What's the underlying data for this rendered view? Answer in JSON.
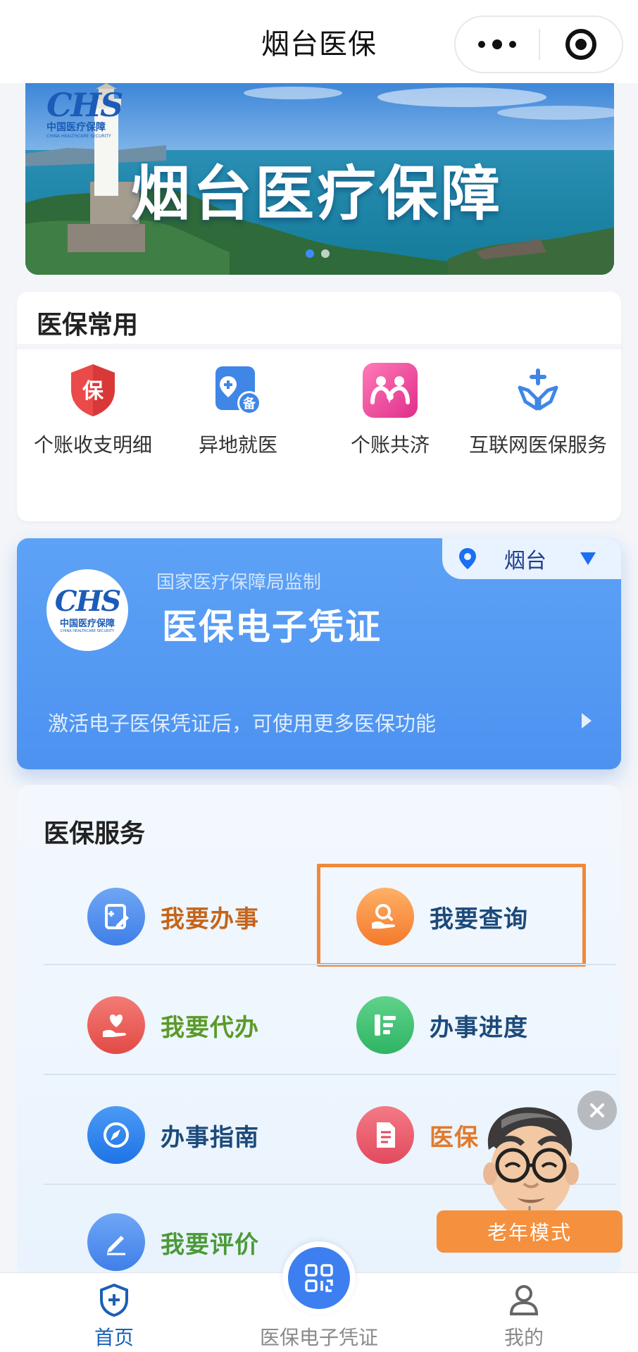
{
  "header": {
    "title": "烟台医保"
  },
  "banner": {
    "headline": "烟台医疗保障",
    "logo": {
      "mark": "CHS",
      "cn": "中国医疗保障",
      "en": "CHINA HEALTHCARE SECURITY"
    },
    "slides_active": 1,
    "slides_total": 2
  },
  "common": {
    "title": "医保常用",
    "items": [
      {
        "label": "个账收支明细",
        "icon": "shield-bao-icon",
        "glyph": "保"
      },
      {
        "label": "异地就医",
        "icon": "remote-filing-icon",
        "glyph": "备"
      },
      {
        "label": "个账共济",
        "icon": "family-share-icon"
      },
      {
        "label": "互联网医保服务",
        "icon": "hands-cross-icon"
      }
    ]
  },
  "credential": {
    "supervision": "国家医疗保障局监制",
    "title": "医保电子凭证",
    "hint": "激活电子医保凭证后，可使用更多医保功能",
    "city": "烟台",
    "logo": {
      "mark": "CHS",
      "cn": "中国医疗保障",
      "en": "CHINA HEALTHCARE SECURITY"
    }
  },
  "services": {
    "title": "医保服务",
    "items": [
      {
        "label": "我要办事",
        "icon": "edit-doc-icon",
        "color": "#c4651c"
      },
      {
        "label": "我要查询",
        "icon": "search-hand-icon",
        "color": "#1c4a7a"
      },
      {
        "label": "我要代办",
        "icon": "heart-hand-icon",
        "color": "#5a9a28"
      },
      {
        "label": "办事进度",
        "icon": "progress-icon",
        "color": "#1c4a7a"
      },
      {
        "label": "办事指南",
        "icon": "compass-icon",
        "color": "#1c4a7a"
      },
      {
        "label": "医保",
        "icon": "document-icon",
        "color": "#e07a2e"
      },
      {
        "label": "我要评价",
        "icon": "pencil-icon",
        "color": "#4a9a38"
      }
    ]
  },
  "elder_mode": {
    "label": "老年模式"
  },
  "tabbar": {
    "tabs": [
      {
        "label": "首页",
        "icon": "home-shield-icon",
        "active": true
      },
      {
        "label": "医保电子凭证",
        "icon": "qr-code-icon",
        "active": false
      },
      {
        "label": "我的",
        "icon": "user-icon",
        "active": false
      }
    ]
  },
  "colors": {
    "accent": "#3d7ff0",
    "highlight": "#f0893a",
    "tab_active": "#1b5fb5",
    "tab_inactive": "#8a8a8a"
  }
}
